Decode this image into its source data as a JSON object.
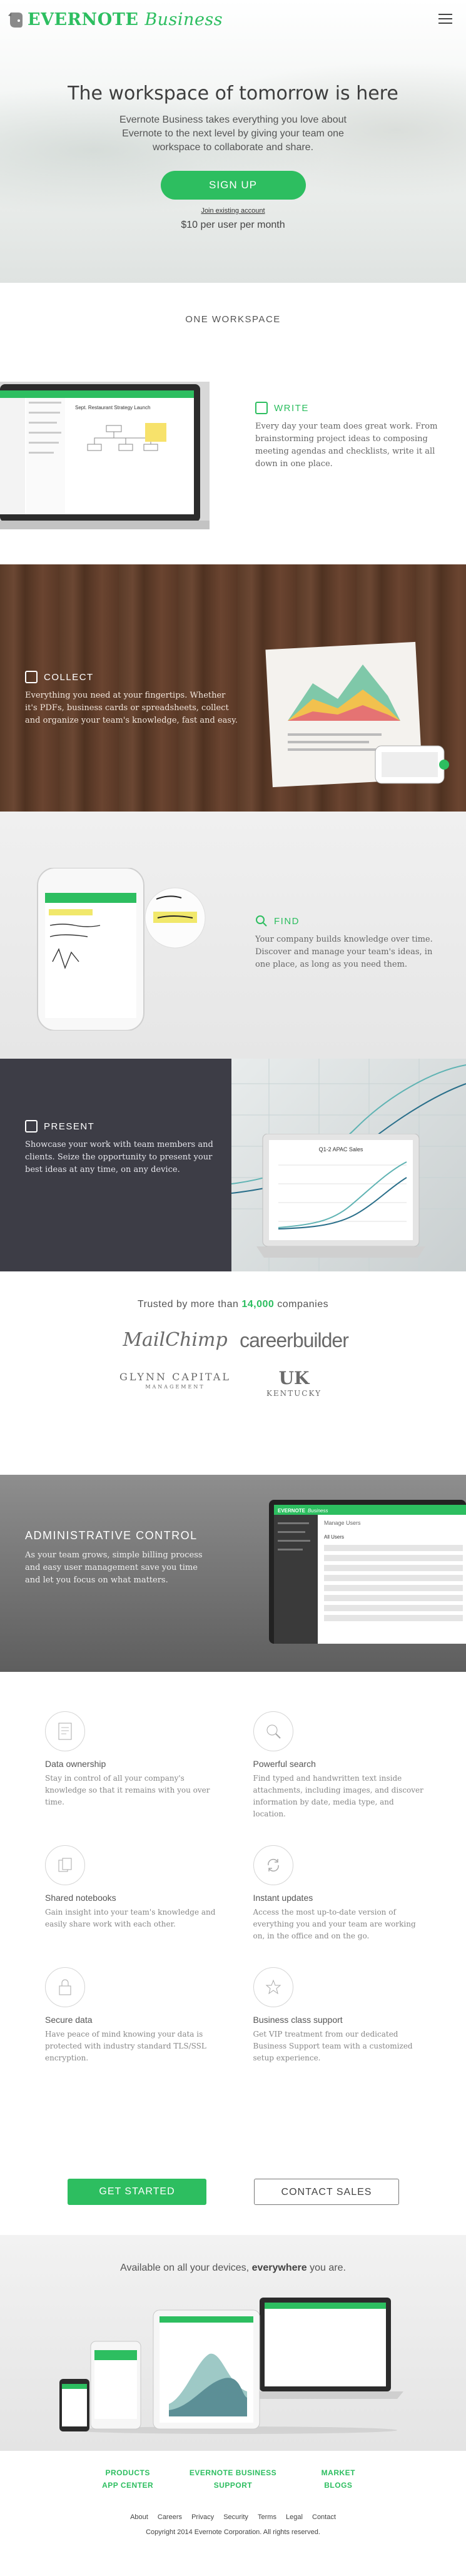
{
  "header": {
    "brand": "EVERNOTE",
    "brand_suffix": "Business",
    "menu_icon": "hamburger-menu-icon"
  },
  "hero": {
    "title": "The workspace of tomorrow is here",
    "subtitle": "Evernote Business takes everything you love about Evernote to the next level by giving your team one workspace to collaborate and share.",
    "signup_label": "SIGN UP",
    "signin_link": "Join existing account",
    "price": "$10 per user per month"
  },
  "one_workspace": {
    "label": "ONE WORKSPACE"
  },
  "features": {
    "write": {
      "title": "WRITE",
      "icon": "write-icon",
      "body": "Every day your team does great work. From brainstorming project ideas to composing meeting agendas and checklists, write it all down in one place."
    },
    "collect": {
      "title": "COLLECT",
      "icon": "collect-icon",
      "body": "Everything you need at your fingertips. Whether it's PDFs, business cards or spreadsheets, collect and organize your team's knowledge, fast and easy."
    },
    "find": {
      "title": "FIND",
      "icon": "search-icon",
      "body": "Your company builds knowledge over time. Discover and manage your team's ideas, in one place, as long as you need them."
    },
    "present": {
      "title": "PRESENT",
      "icon": "present-icon",
      "body": "Showcase your work with team members and clients. Seize the opportunity to present your best ideas at any time, on any device."
    }
  },
  "mockups": {
    "laptop_note_title": "Sept. Restaurant Strategy Launch",
    "present_chart_title": "Q1-2 APAC Sales",
    "admin_screen_brand": "EVERNOTE",
    "admin_screen_brand_suffix": "Business",
    "admin_manage_users": "Manage Users",
    "admin_all_users": "All Users"
  },
  "trusted": {
    "prefix": "Trusted by more than",
    "count": "14,000",
    "suffix": "companies",
    "logos": [
      {
        "name": "MailChimp",
        "sub": ""
      },
      {
        "name": "careerbuilder",
        "sub": ""
      },
      {
        "name": "GLYNN CAPITAL",
        "sub": "MANAGEMENT"
      },
      {
        "name": "UK",
        "sub": "KENTUCKY"
      }
    ]
  },
  "admin": {
    "title": "ADMINISTRATIVE CONTROL",
    "body": "As your team grows, simple billing process and easy user management save you time and let you focus on what matters."
  },
  "benefits": [
    {
      "icon": "document-lock-icon",
      "title": "Data ownership",
      "body": "Stay in control of all your company's knowledge so that it remains with you over time."
    },
    {
      "icon": "search-icon",
      "title": "Powerful search",
      "body": "Find typed and handwritten text inside attachments, including images, and discover information by date, media type, and location."
    },
    {
      "icon": "notebooks-icon",
      "title": "Shared notebooks",
      "body": "Gain insight into your team's knowledge and easily share work with each other."
    },
    {
      "icon": "sync-icon",
      "title": "Instant updates",
      "body": "Access the most up-to-date version of everything you and your team are working on, in the office and on the go."
    },
    {
      "icon": "lock-icon",
      "title": "Secure data",
      "body": "Have peace of mind knowing your data is protected with industry standard TLS/SSL encryption."
    },
    {
      "icon": "star-icon",
      "title": "Business class support",
      "body": "Get VIP treatment from our dedicated Business Support team with a customized setup experience."
    }
  ],
  "cta": {
    "primary": "GET STARTED",
    "secondary": "CONTACT SALES"
  },
  "devices": {
    "prefix": "Available on all your devices,",
    "emphasis": "everywhere",
    "suffix": "you are."
  },
  "footer": {
    "nav": [
      "PRODUCTS",
      "EVERNOTE BUSINESS",
      "MARKET",
      "APP CENTER",
      "SUPPORT",
      "BLOGS"
    ],
    "links": [
      "About",
      "Careers",
      "Privacy",
      "Security",
      "Terms",
      "Legal",
      "Contact"
    ],
    "copyright": "Copyright 2014 Evernote Corporation. All rights reserved."
  },
  "colors": {
    "brand_green": "#2dbe60",
    "wood": "#5a3b28",
    "present_bg": "#3d3d46",
    "admin_bg": "#777777"
  }
}
